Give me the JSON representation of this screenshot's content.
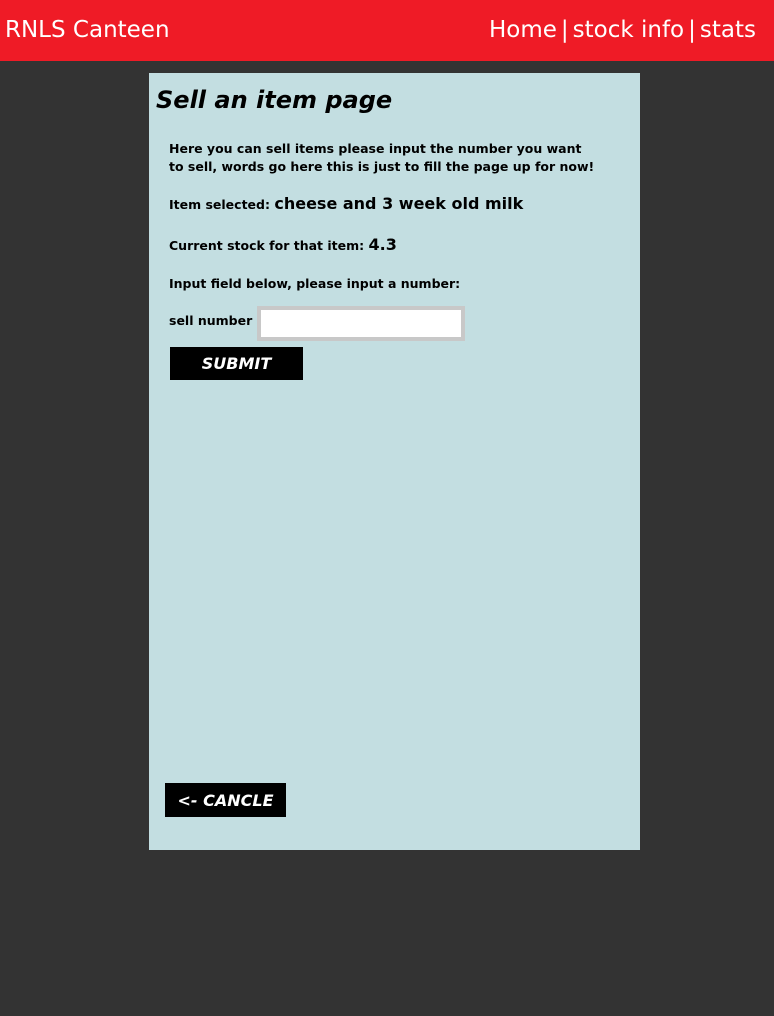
{
  "header": {
    "brand": "RNLS Canteen",
    "nav": [
      {
        "label": "Home"
      },
      {
        "label": "stock info"
      },
      {
        "label": "stats"
      }
    ],
    "separator": "|",
    "background_color": "#ef1b26"
  },
  "main": {
    "title": "Sell an item page",
    "intro": "Here you can sell items please input the number you want to sell, words go here this is just to fill the page up for now!",
    "item_selected_label": "Item selected:",
    "item_selected_value": "cheese and 3 week old milk",
    "stock_label": "Current stock for that item:",
    "stock_value": "4.3",
    "input_prompt": "Input field below, please input a number:",
    "sell_label": "sell number",
    "sell_value": "",
    "submit_label": "SUBMIT",
    "cancel_label": "<- CANCLE",
    "panel_color": "#c3dee1"
  },
  "page": {
    "background_color": "#333333"
  }
}
